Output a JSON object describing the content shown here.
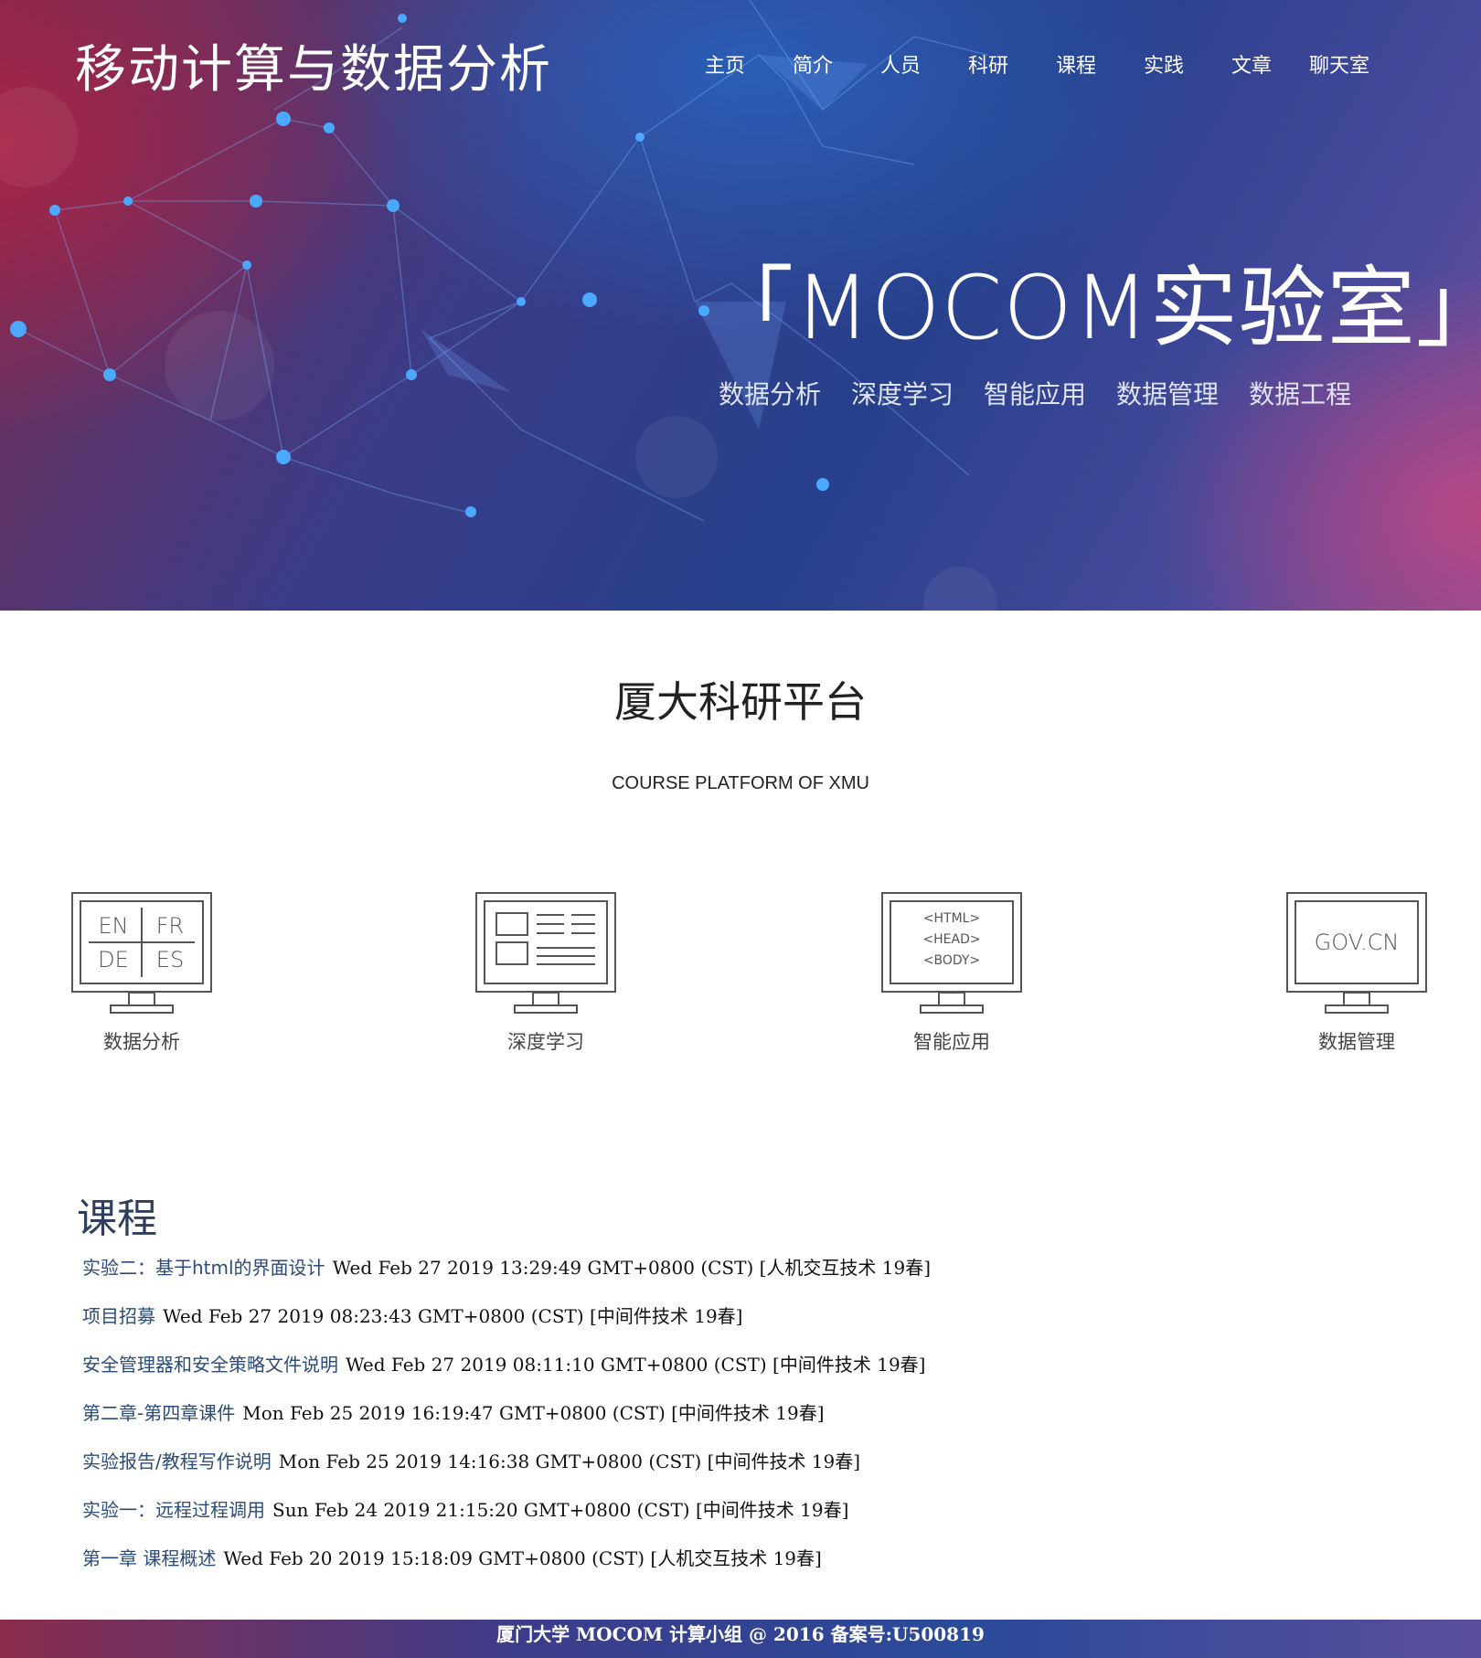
{
  "header": {
    "site_title": "移动计算与数据分析",
    "nav": [
      "主页",
      "简介",
      "人员",
      "科研",
      "课程",
      "实践",
      "文章",
      "聊天室"
    ]
  },
  "hero": {
    "lab_title": "「MOCOM实验室」",
    "tags": [
      "数据分析",
      "深度学习",
      "智能应用",
      "数据管理",
      "数据工程"
    ]
  },
  "platform": {
    "title": "厦大科研平台",
    "subtitle": "COURSE PLATFORM OF XMU",
    "features": [
      {
        "label": "数据分析",
        "icon": "monitor-languages-icon",
        "screen_text": [
          "EN",
          "FR",
          "DE",
          "ES"
        ]
      },
      {
        "label": "深度学习",
        "icon": "monitor-layout-icon",
        "screen_text": []
      },
      {
        "label": "智能应用",
        "icon": "monitor-html-icon",
        "screen_text": [
          "<HTML>",
          "<HEAD>",
          "<BODY>"
        ]
      },
      {
        "label": "数据管理",
        "icon": "monitor-gov-icon",
        "screen_text": [
          "GOV.CN"
        ]
      }
    ]
  },
  "courses": {
    "heading": "课程",
    "items": [
      {
        "title": "实验二：基于html的界面设计",
        "meta": "Wed Feb 27 2019 13:29:49 GMT+0800 (CST) [人机交互技术 19春]"
      },
      {
        "title": "项目招募",
        "meta": "Wed Feb 27 2019 08:23:43 GMT+0800 (CST) [中间件技术 19春]"
      },
      {
        "title": "安全管理器和安全策略文件说明",
        "meta": "Wed Feb 27 2019 08:11:10 GMT+0800 (CST) [中间件技术 19春]"
      },
      {
        "title": "第二章-第四章课件",
        "meta": "Mon Feb 25 2019 16:19:47 GMT+0800 (CST) [中间件技术 19春]"
      },
      {
        "title": "实验报告/教程写作说明",
        "meta": "Mon Feb 25 2019 14:16:38 GMT+0800 (CST) [中间件技术 19春]"
      },
      {
        "title": "实验一：远程过程调用",
        "meta": "Sun Feb 24 2019 21:15:20 GMT+0800 (CST) [中间件技术 19春]"
      },
      {
        "title": "第一章 课程概述",
        "meta": "Wed Feb 20 2019 15:18:09 GMT+0800 (CST) [人机交互技术 19春]"
      }
    ]
  },
  "footer": {
    "text": "厦门大学 MOCOM 计算小组 @ 2016 备案号:U500819"
  }
}
